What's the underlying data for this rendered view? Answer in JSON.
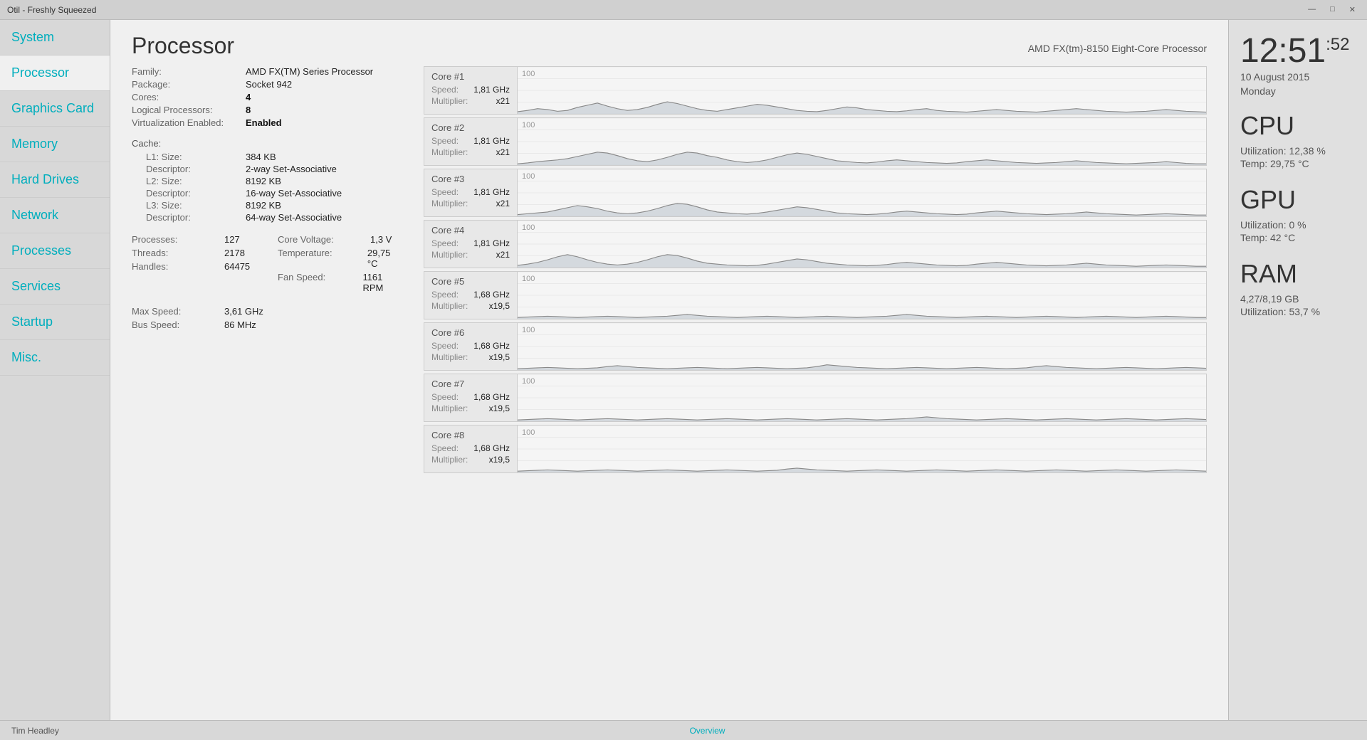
{
  "app": {
    "title": "Otil - Freshly Squeezed",
    "footer_left": "Tim Headley",
    "footer_center": "Overview"
  },
  "titlebar": {
    "minimize": "—",
    "maximize": "□",
    "close": "✕"
  },
  "sidebar": {
    "items": [
      {
        "id": "system",
        "label": "System",
        "active": false
      },
      {
        "id": "processor",
        "label": "Processor",
        "active": true
      },
      {
        "id": "graphics-card",
        "label": "Graphics Card",
        "active": false
      },
      {
        "id": "memory",
        "label": "Memory",
        "active": false
      },
      {
        "id": "hard-drives",
        "label": "Hard Drives",
        "active": false
      },
      {
        "id": "network",
        "label": "Network",
        "active": false
      },
      {
        "id": "processes",
        "label": "Processes",
        "active": false
      },
      {
        "id": "services",
        "label": "Services",
        "active": false
      },
      {
        "id": "startup",
        "label": "Startup",
        "active": false
      },
      {
        "id": "misc",
        "label": "Misc.",
        "active": false
      }
    ]
  },
  "page": {
    "title": "Processor",
    "processor_model": "AMD FX(tm)-8150 Eight-Core Processor"
  },
  "processor_info": {
    "family_label": "Family:",
    "family_value": "AMD FX(TM) Series Processor",
    "package_label": "Package:",
    "package_value": "Socket 942",
    "cores_label": "Cores:",
    "cores_value": "4",
    "logical_label": "Logical Processors:",
    "logical_value": "8",
    "virt_label": "Virtualization Enabled:",
    "virt_value": "Enabled",
    "cache_header": "Cache:",
    "l1_size_label": "L1:   Size:",
    "l1_size_value": "384 KB",
    "l1_desc_label": "Descriptor:",
    "l1_desc_value": "2-way Set-Associative",
    "l2_size_label": "L2:   Size:",
    "l2_size_value": "8192 KB",
    "l2_desc_label": "Descriptor:",
    "l2_desc_value": "16-way Set-Associative",
    "l3_size_label": "L3:   Size:",
    "l3_size_value": "8192 KB",
    "l3_desc_label": "Descriptor:",
    "l3_desc_value": "64-way Set-Associative",
    "processes_label": "Processes:",
    "processes_value": "127",
    "threads_label": "Threads:",
    "threads_value": "2178",
    "handles_label": "Handles:",
    "handles_value": "64475",
    "core_voltage_label": "Core Voltage:",
    "core_voltage_value": "1,3 V",
    "temperature_label": "Temperature:",
    "temperature_value": "29,75 °C",
    "fan_speed_label": "Fan Speed:",
    "fan_speed_value": "1161 RPM",
    "max_speed_label": "Max Speed:",
    "max_speed_value": "3,61 GHz",
    "bus_speed_label": "Bus Speed:",
    "bus_speed_value": "86 MHz"
  },
  "cores": [
    {
      "name": "Core #1",
      "speed": "1,81 GHz",
      "multiplier": "x21",
      "graph_label": "100"
    },
    {
      "name": "Core #2",
      "speed": "1,81 GHz",
      "multiplier": "x21",
      "graph_label": "100"
    },
    {
      "name": "Core #3",
      "speed": "1,81 GHz",
      "multiplier": "x21",
      "graph_label": "100"
    },
    {
      "name": "Core #4",
      "speed": "1,81 GHz",
      "multiplier": "x21",
      "graph_label": "100"
    },
    {
      "name": "Core #5",
      "speed": "1,68 GHz",
      "multiplier": "x19,5",
      "graph_label": "100"
    },
    {
      "name": "Core #6",
      "speed": "1,68 GHz",
      "multiplier": "x19,5",
      "graph_label": "100"
    },
    {
      "name": "Core #7",
      "speed": "1,68 GHz",
      "multiplier": "x19,5",
      "graph_label": "100"
    },
    {
      "name": "Core #8",
      "speed": "1,68 GHz",
      "multiplier": "x19,5",
      "graph_label": "100"
    }
  ],
  "right_panel": {
    "time": "12:51",
    "seconds": ":52",
    "date_line1": "10 August 2015",
    "date_line2": "Monday",
    "cpu_title": "CPU",
    "cpu_utilization": "Utilization: 12,38 %",
    "cpu_temp": "Temp: 29,75 °C",
    "gpu_title": "GPU",
    "gpu_utilization": "Utilization: 0 %",
    "gpu_temp": "Temp: 42 °C",
    "ram_title": "RAM",
    "ram_usage": "4,27/8,19 GB",
    "ram_utilization": "Utilization: 53,7 %"
  },
  "graph_data": {
    "core1": [
      5,
      8,
      12,
      10,
      6,
      8,
      15,
      20,
      25,
      18,
      12,
      8,
      10,
      15,
      22,
      28,
      24,
      18,
      12,
      8,
      6,
      10,
      14,
      18,
      22,
      20,
      16,
      12,
      8,
      6,
      5,
      8,
      12,
      16,
      14,
      10,
      8,
      6,
      5,
      7,
      10,
      12,
      8,
      6,
      5,
      4,
      6,
      8,
      10,
      8,
      6,
      5,
      4,
      6,
      8,
      10,
      12,
      10,
      8,
      6,
      5,
      4,
      5,
      6,
      8,
      10,
      8,
      6,
      5,
      4
    ],
    "core2": [
      3,
      5,
      8,
      10,
      12,
      15,
      20,
      25,
      30,
      28,
      22,
      15,
      10,
      8,
      12,
      18,
      25,
      30,
      28,
      22,
      18,
      12,
      8,
      6,
      8,
      12,
      18,
      24,
      28,
      25,
      20,
      15,
      10,
      8,
      6,
      5,
      7,
      10,
      12,
      10,
      8,
      6,
      5,
      4,
      5,
      8,
      10,
      12,
      10,
      8,
      6,
      5,
      4,
      5,
      6,
      8,
      10,
      8,
      6,
      5,
      4,
      3,
      4,
      5,
      6,
      8,
      6,
      4,
      3,
      3
    ],
    "core3": [
      4,
      6,
      8,
      10,
      15,
      20,
      25,
      22,
      18,
      12,
      8,
      6,
      8,
      12,
      18,
      25,
      30,
      28,
      22,
      15,
      10,
      8,
      6,
      5,
      7,
      10,
      14,
      18,
      22,
      20,
      16,
      12,
      8,
      6,
      5,
      4,
      5,
      7,
      10,
      12,
      10,
      8,
      6,
      5,
      4,
      5,
      8,
      10,
      12,
      10,
      8,
      6,
      5,
      4,
      5,
      6,
      8,
      10,
      8,
      6,
      5,
      4,
      3,
      4,
      5,
      6,
      5,
      4,
      3,
      3
    ],
    "core4": [
      5,
      8,
      12,
      18,
      25,
      30,
      25,
      18,
      12,
      8,
      6,
      8,
      12,
      18,
      25,
      30,
      28,
      22,
      15,
      10,
      8,
      6,
      5,
      4,
      5,
      8,
      12,
      16,
      20,
      18,
      14,
      10,
      8,
      6,
      5,
      4,
      5,
      7,
      10,
      12,
      10,
      8,
      6,
      5,
      4,
      5,
      8,
      10,
      12,
      10,
      8,
      6,
      5,
      4,
      5,
      6,
      8,
      10,
      8,
      6,
      5,
      4,
      3,
      4,
      5,
      6,
      5,
      4,
      3,
      3
    ],
    "core5": [
      3,
      4,
      5,
      6,
      5,
      4,
      3,
      4,
      5,
      6,
      5,
      4,
      3,
      4,
      5,
      6,
      8,
      10,
      8,
      6,
      5,
      4,
      3,
      4,
      5,
      6,
      5,
      4,
      3,
      4,
      5,
      6,
      5,
      4,
      3,
      4,
      5,
      6,
      8,
      10,
      8,
      6,
      5,
      4,
      3,
      4,
      5,
      6,
      5,
      4,
      3,
      4,
      5,
      6,
      5,
      4,
      3,
      4,
      5,
      6,
      5,
      4,
      3,
      4,
      5,
      6,
      5,
      4,
      3,
      3
    ],
    "core6": [
      3,
      4,
      5,
      6,
      5,
      4,
      3,
      4,
      5,
      8,
      10,
      8,
      6,
      5,
      4,
      3,
      4,
      5,
      6,
      5,
      4,
      3,
      4,
      5,
      6,
      5,
      4,
      3,
      4,
      5,
      8,
      12,
      10,
      8,
      6,
      5,
      4,
      3,
      4,
      5,
      6,
      5,
      4,
      3,
      4,
      5,
      6,
      5,
      4,
      3,
      4,
      5,
      8,
      10,
      8,
      6,
      5,
      4,
      3,
      4,
      5,
      6,
      5,
      4,
      3,
      4,
      5,
      6,
      5,
      4
    ],
    "core7": [
      3,
      4,
      5,
      6,
      5,
      4,
      3,
      4,
      5,
      6,
      5,
      4,
      3,
      4,
      5,
      6,
      5,
      4,
      3,
      4,
      5,
      6,
      5,
      4,
      3,
      4,
      5,
      6,
      5,
      4,
      3,
      4,
      5,
      6,
      5,
      4,
      3,
      4,
      5,
      6,
      8,
      10,
      8,
      6,
      5,
      4,
      3,
      4,
      5,
      6,
      5,
      4,
      3,
      4,
      5,
      6,
      5,
      4,
      3,
      4,
      5,
      6,
      5,
      4,
      3,
      4,
      5,
      6,
      5,
      4
    ],
    "core8": [
      3,
      4,
      5,
      6,
      5,
      4,
      3,
      4,
      5,
      6,
      5,
      4,
      3,
      4,
      5,
      6,
      5,
      4,
      3,
      4,
      5,
      6,
      5,
      4,
      3,
      4,
      5,
      8,
      10,
      8,
      6,
      5,
      4,
      3,
      4,
      5,
      6,
      5,
      4,
      3,
      4,
      5,
      6,
      5,
      4,
      3,
      4,
      5,
      6,
      5,
      4,
      3,
      4,
      5,
      6,
      5,
      4,
      3,
      4,
      5,
      6,
      5,
      4,
      3,
      4,
      5,
      6,
      5,
      4,
      3
    ]
  }
}
